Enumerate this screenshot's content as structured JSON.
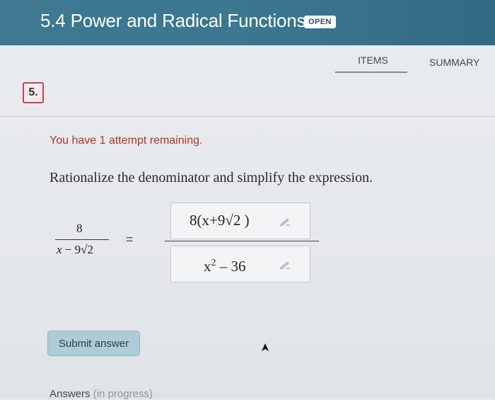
{
  "header": {
    "title": "5.4 Power and Radical Functions",
    "badge": "OPEN"
  },
  "tabs": {
    "items": "ITEMS",
    "summary": "SUMMARY"
  },
  "question": {
    "number": "5.",
    "attempts": "You have 1 attempt remaining.",
    "instruction": "Rationalize the denominator and simplify the expression."
  },
  "expression": {
    "numerator": "8",
    "denominator_var": "x",
    "denominator_rest": " − 9√2",
    "equals": "="
  },
  "answer": {
    "numerator": "8(x+9√2 )",
    "denominator_base": "x",
    "denominator_exp": "2",
    "denominator_rest": " – 36"
  },
  "actions": {
    "submit_label": "Submit answer"
  },
  "footer": {
    "answers_label": "Answers",
    "status": "(in progress)"
  },
  "colors": {
    "header": "#3c7891",
    "attempts_text": "#b0332a",
    "question_badge_border": "#c0455e",
    "submit_bg": "#aeccd8"
  },
  "icons": [
    "pencil-icon",
    "cursor-icon"
  ]
}
